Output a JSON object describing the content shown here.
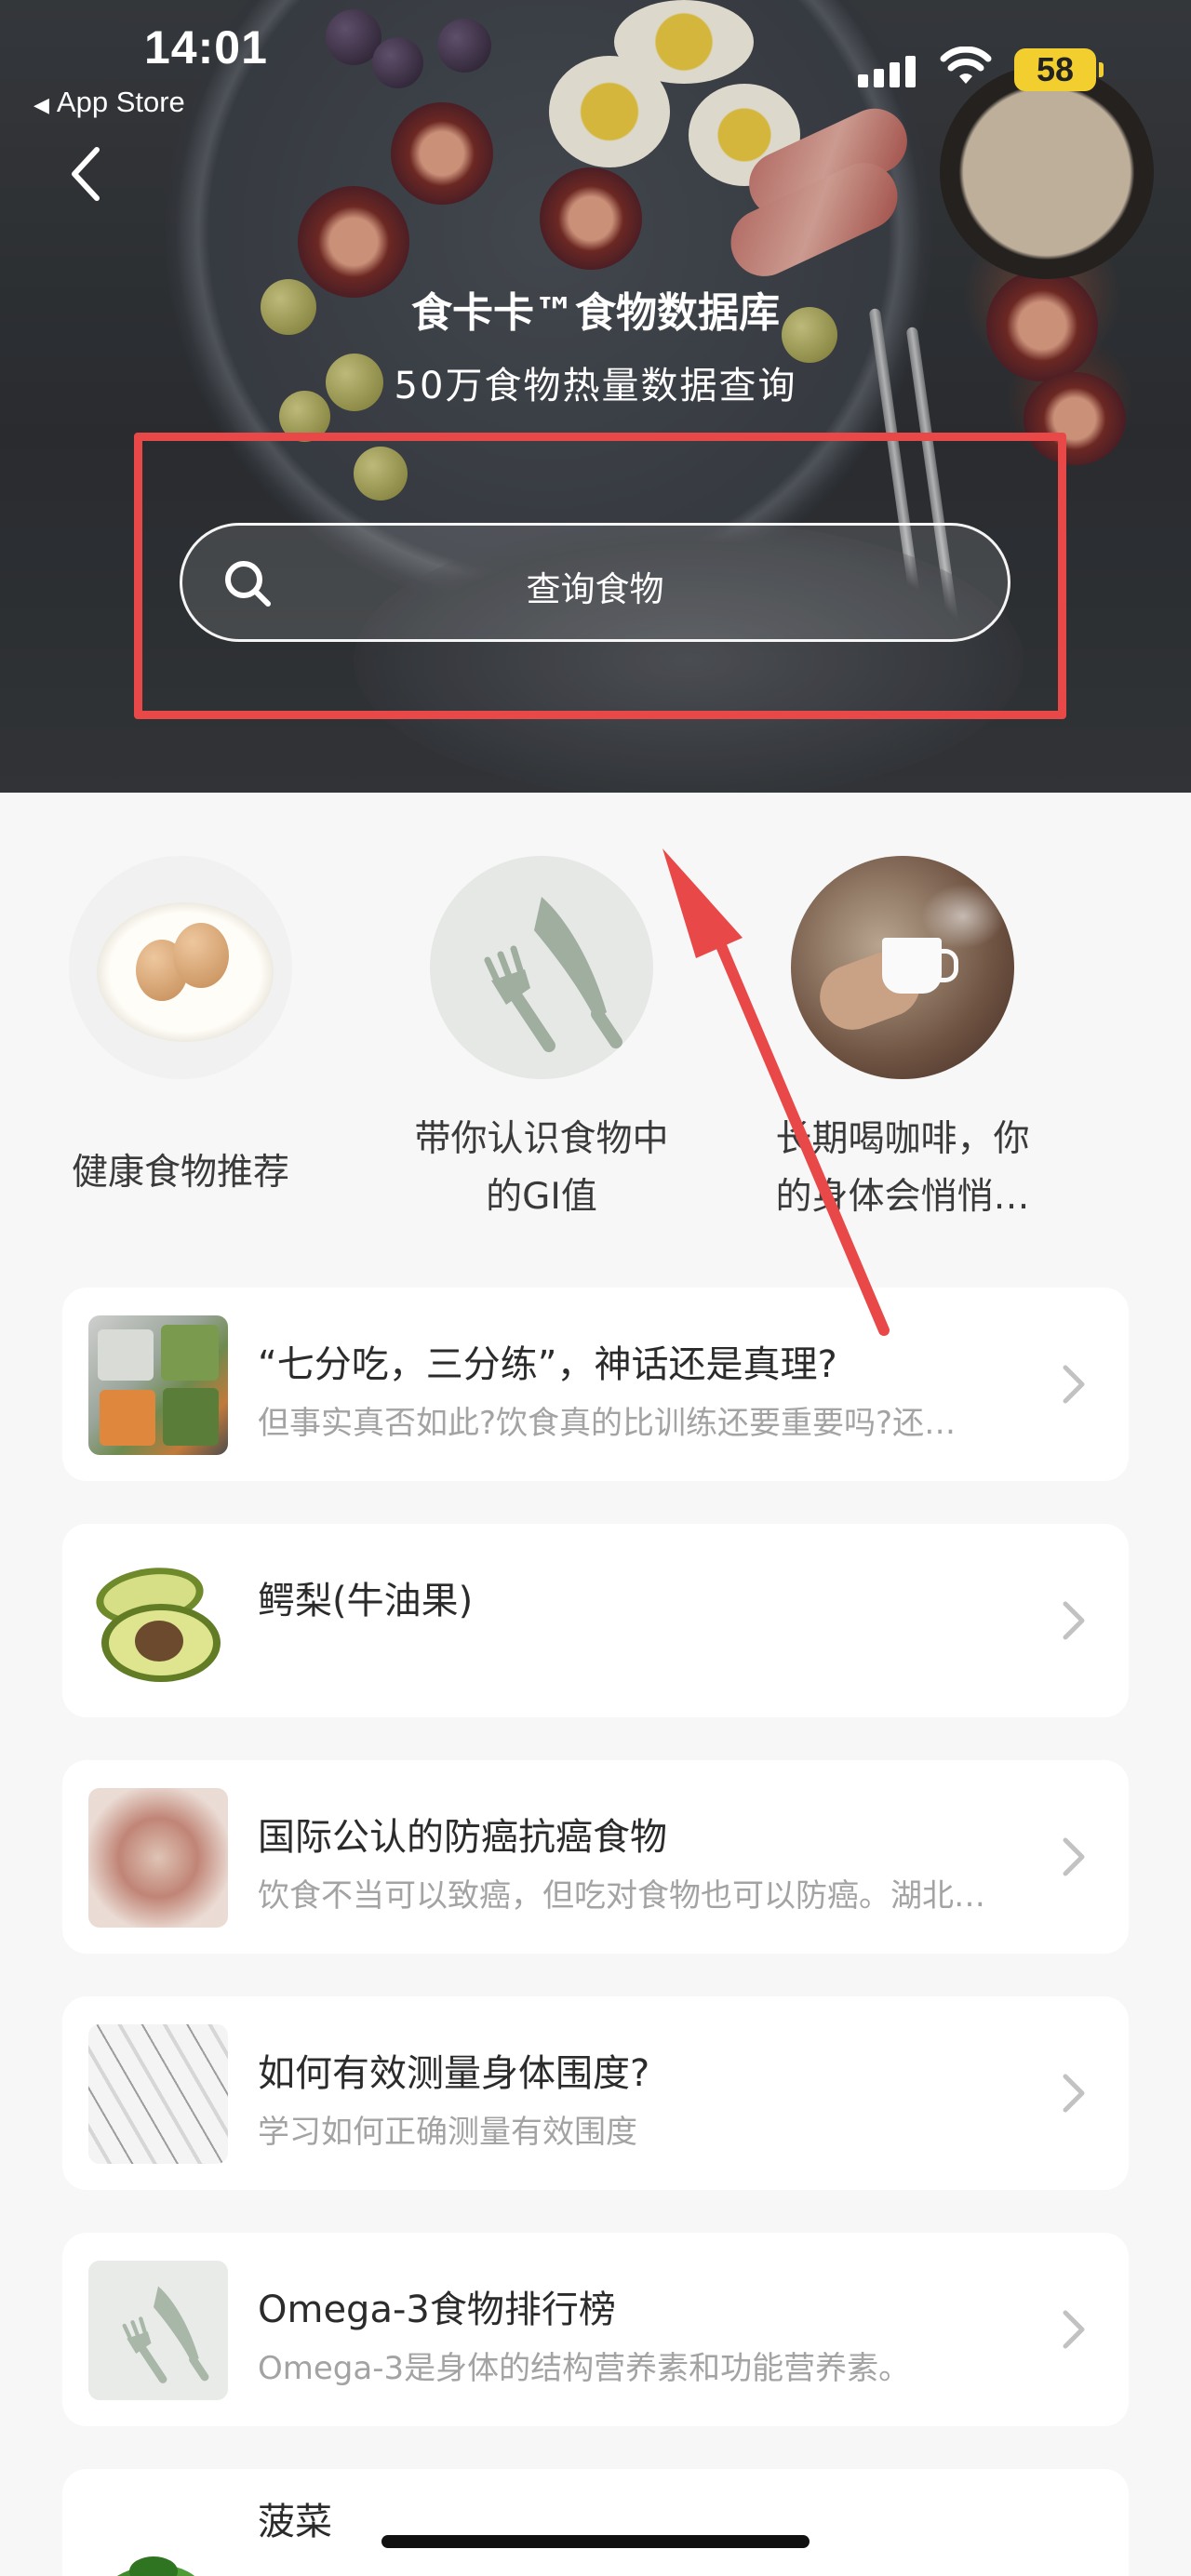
{
  "status_bar": {
    "time": "14:01",
    "back_app": "App Store",
    "battery": "58"
  },
  "header": {
    "back_icon": "chevron-left-icon",
    "title": "食卡卡™食物数据库",
    "subtitle": "50万食物热量数据查询"
  },
  "search": {
    "placeholder": "查询食物",
    "icon": "search-icon"
  },
  "annotation": {
    "highlight_color": "#e94848"
  },
  "categories": [
    {
      "label": "健康食物推荐"
    },
    {
      "label_line1": "带你认识食物中",
      "label_line2": "的GI值"
    },
    {
      "label_line1": "长期喝咖啡，你",
      "label_line2": "的身体会悄悄…"
    }
  ],
  "articles": [
    {
      "title": "“七分吃，三分练”，神话还是真理?",
      "subtitle": "但事实真否如此?饮食真的比训练还要重要吗?还…"
    },
    {
      "title": "鳄梨(牛油果)",
      "subtitle": ""
    },
    {
      "title": "国际公认的防癌抗癌食物",
      "subtitle": "饮食不当可以致癌，但吃对食物也可以防癌。湖北…"
    },
    {
      "title": "如何有效测量身体围度?",
      "subtitle": "学习如何正确测量有效围度"
    },
    {
      "title": "Omega-3食物排行榜",
      "subtitle": "Omega-3是身体的结构营养素和功能营养素。"
    },
    {
      "title": "菠菜",
      "subtitle": ""
    }
  ]
}
